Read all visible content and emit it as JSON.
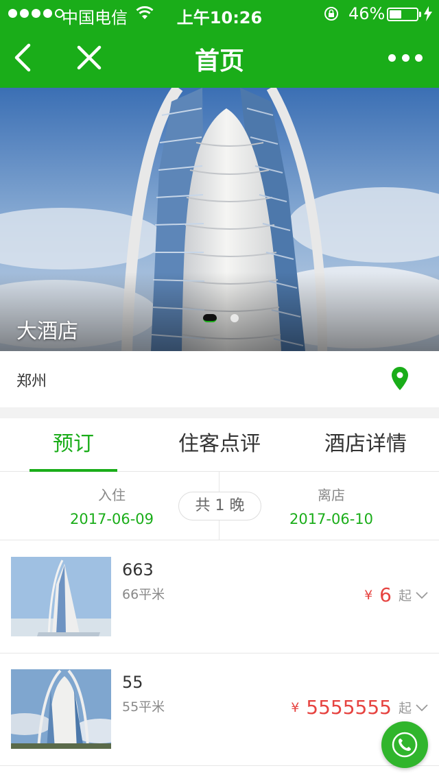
{
  "status_bar": {
    "carrier": "中国电信",
    "time": "上午10:26",
    "battery_percent": "46%",
    "battery_level": 0.46,
    "signal_bars": 4
  },
  "nav": {
    "title": "首页"
  },
  "banner": {
    "title": "大酒店",
    "slide_count": 2,
    "active_slide": 1
  },
  "location": {
    "city": "郑州"
  },
  "tabs": [
    {
      "label": "预订",
      "active": true
    },
    {
      "label": "住客点评",
      "active": false
    },
    {
      "label": "酒店详情",
      "active": false
    }
  ],
  "dates": {
    "checkin_label": "入住",
    "checkin_date": "2017-06-09",
    "checkout_label": "离店",
    "checkout_date": "2017-06-10",
    "nights": "共 1 晚"
  },
  "rooms": [
    {
      "name": "663",
      "area": "66平米",
      "currency": "¥",
      "price": "6",
      "from_label": "起"
    },
    {
      "name": "55",
      "area": "55平米",
      "currency": "¥",
      "price": "5555555",
      "from_label": "起"
    }
  ],
  "colors": {
    "brand_green": "#1aad19",
    "price_red": "#e64340"
  },
  "icons": {
    "nav_back": "chevron-left-icon",
    "nav_close": "close-icon",
    "nav_more": "more-dots-icon",
    "location": "location-pin-icon",
    "phone": "phone-icon"
  }
}
